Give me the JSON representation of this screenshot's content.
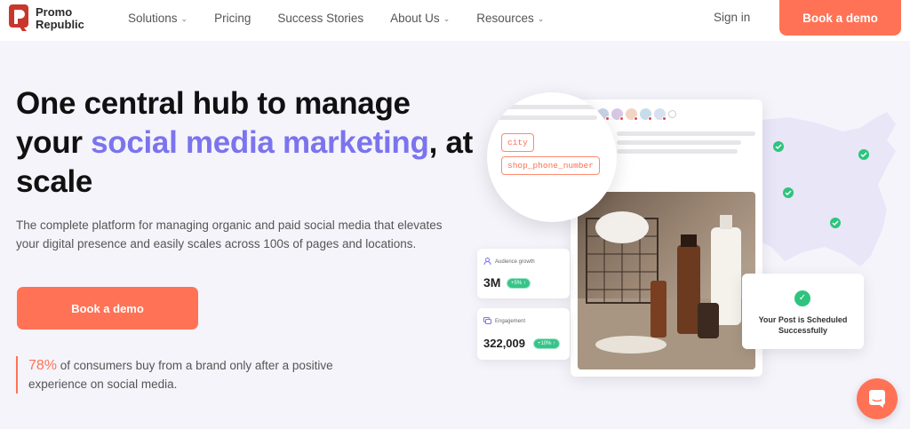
{
  "nav": {
    "logo_line1": "Promo",
    "logo_line2": "Republic",
    "items": [
      {
        "label": "Solutions",
        "has_menu": true
      },
      {
        "label": "Pricing",
        "has_menu": false
      },
      {
        "label": "Success Stories",
        "has_menu": false
      },
      {
        "label": "About Us",
        "has_menu": true
      },
      {
        "label": "Resources",
        "has_menu": true
      }
    ],
    "signin": "Sign in",
    "cta": "Book a demo",
    "chevron": "⌄"
  },
  "hero": {
    "title_part1": "One central hub to manage your ",
    "title_highlight": "social media marketing",
    "title_part2": ", at scale",
    "subtitle": "The complete platform for managing organic and paid social media that elevates your digital presence and easily scales across 100s of pages and locations.",
    "cta": "Book a demo",
    "stat_percent": "78%",
    "stat_text": " of consumers buy from a brand only after a positive experience on social media."
  },
  "illustration": {
    "tags": [
      "city",
      "shop_phone_number"
    ],
    "audience": {
      "label": "Audience growth",
      "value": "3M",
      "badge": "+5% ↑"
    },
    "engagement": {
      "label": "Engagement",
      "value": "322,009",
      "badge": "+10% ↑"
    },
    "scheduled": "Your Post is Scheduled Successfully",
    "map_pins": 5
  },
  "colors": {
    "accent": "#ff7256",
    "highlight": "#7b74ee",
    "success": "#2ec47e"
  }
}
